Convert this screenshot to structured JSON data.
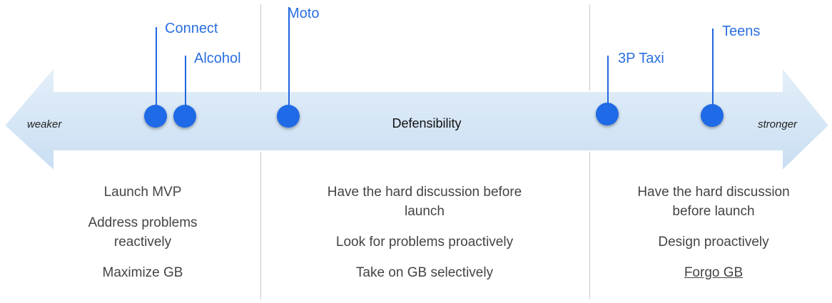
{
  "axis": {
    "label": "Defensibility",
    "left_end": "weaker",
    "right_end": "stronger",
    "arrow_color": "#d4e6f7",
    "marker_color": "#1f6ae6"
  },
  "markers": [
    {
      "label": "Connect"
    },
    {
      "label": "Alcohol"
    },
    {
      "label": "Moto"
    },
    {
      "label": "3P Taxi"
    },
    {
      "label": "Teens"
    }
  ],
  "columns": [
    {
      "items": [
        "Launch MVP",
        "Address problems reactively",
        "Maximize GB"
      ]
    },
    {
      "items": [
        "Have the hard discussion before launch",
        "Look for problems proactively",
        "Take on GB selectively"
      ]
    },
    {
      "items": [
        "Have the hard discussion before launch",
        "Design proactively",
        "Forgo GB"
      ]
    }
  ]
}
